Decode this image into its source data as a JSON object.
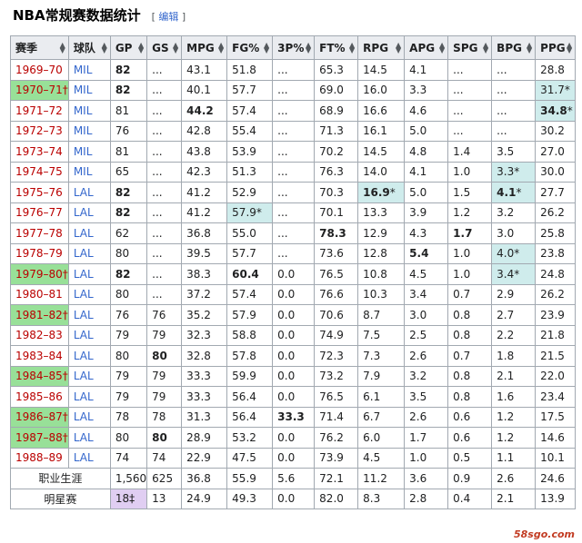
{
  "section": {
    "title": "NBA常规赛数据统计",
    "edit_open": "[",
    "edit_label": "编辑",
    "edit_close": "]"
  },
  "columns": [
    "赛季",
    "球队",
    "GP",
    "GS",
    "MPG",
    "FG%",
    "3P%",
    "FT%",
    "RPG",
    "APG",
    "SPG",
    "BPG",
    "PPG"
  ],
  "colors": {
    "champion": "#98e098",
    "league_leader": "#cfecec",
    "all_star_count": "#e0cef2",
    "link": "#3366cc",
    "redlink": "#ba0000"
  },
  "rows": [
    {
      "season": "1969–70",
      "champ": false,
      "team": "MIL",
      "cells": [
        {
          "v": "82",
          "b": true
        },
        {
          "v": "..."
        },
        {
          "v": "43.1"
        },
        {
          "v": "51.8"
        },
        {
          "v": "..."
        },
        {
          "v": "65.3"
        },
        {
          "v": "14.5"
        },
        {
          "v": "4.1"
        },
        {
          "v": "..."
        },
        {
          "v": "..."
        },
        {
          "v": "28.8"
        }
      ]
    },
    {
      "season": "1970–71†",
      "champ": true,
      "team": "MIL",
      "cells": [
        {
          "v": "82",
          "b": true
        },
        {
          "v": "..."
        },
        {
          "v": "40.1"
        },
        {
          "v": "57.7"
        },
        {
          "v": "..."
        },
        {
          "v": "69.0"
        },
        {
          "v": "16.0"
        },
        {
          "v": "3.3"
        },
        {
          "v": "..."
        },
        {
          "v": "..."
        },
        {
          "v": "31.7*",
          "hl": true
        }
      ]
    },
    {
      "season": "1971–72",
      "champ": false,
      "team": "MIL",
      "cells": [
        {
          "v": "81"
        },
        {
          "v": "..."
        },
        {
          "v": "44.2",
          "b": true
        },
        {
          "v": "57.4"
        },
        {
          "v": "..."
        },
        {
          "v": "68.9"
        },
        {
          "v": "16.6"
        },
        {
          "v": "4.6"
        },
        {
          "v": "..."
        },
        {
          "v": "..."
        },
        {
          "v": "34.8",
          "b": true,
          "suffix": "*",
          "hl": true
        }
      ]
    },
    {
      "season": "1972–73",
      "champ": false,
      "team": "MIL",
      "cells": [
        {
          "v": "76"
        },
        {
          "v": "..."
        },
        {
          "v": "42.8"
        },
        {
          "v": "55.4"
        },
        {
          "v": "..."
        },
        {
          "v": "71.3"
        },
        {
          "v": "16.1"
        },
        {
          "v": "5.0"
        },
        {
          "v": "..."
        },
        {
          "v": "..."
        },
        {
          "v": "30.2"
        }
      ]
    },
    {
      "season": "1973–74",
      "champ": false,
      "team": "MIL",
      "cells": [
        {
          "v": "81"
        },
        {
          "v": "..."
        },
        {
          "v": "43.8"
        },
        {
          "v": "53.9"
        },
        {
          "v": "..."
        },
        {
          "v": "70.2"
        },
        {
          "v": "14.5"
        },
        {
          "v": "4.8"
        },
        {
          "v": "1.4"
        },
        {
          "v": "3.5"
        },
        {
          "v": "27.0"
        }
      ]
    },
    {
      "season": "1974–75",
      "champ": false,
      "team": "MIL",
      "cells": [
        {
          "v": "65"
        },
        {
          "v": "..."
        },
        {
          "v": "42.3"
        },
        {
          "v": "51.3"
        },
        {
          "v": "..."
        },
        {
          "v": "76.3"
        },
        {
          "v": "14.0"
        },
        {
          "v": "4.1"
        },
        {
          "v": "1.0"
        },
        {
          "v": "3.3*",
          "hl": true
        },
        {
          "v": "30.0"
        }
      ]
    },
    {
      "season": "1975–76",
      "champ": false,
      "team": "LAL",
      "cells": [
        {
          "v": "82",
          "b": true
        },
        {
          "v": "..."
        },
        {
          "v": "41.2"
        },
        {
          "v": "52.9"
        },
        {
          "v": "..."
        },
        {
          "v": "70.3"
        },
        {
          "v": "16.9",
          "b": true,
          "suffix": "*",
          "hl": true
        },
        {
          "v": "5.0"
        },
        {
          "v": "1.5"
        },
        {
          "v": "4.1",
          "b": true,
          "suffix": "*",
          "hl": true
        },
        {
          "v": "27.7"
        }
      ]
    },
    {
      "season": "1976–77",
      "champ": false,
      "team": "LAL",
      "cells": [
        {
          "v": "82",
          "b": true
        },
        {
          "v": "..."
        },
        {
          "v": "41.2"
        },
        {
          "v": "57.9*",
          "hl": true
        },
        {
          "v": "..."
        },
        {
          "v": "70.1"
        },
        {
          "v": "13.3"
        },
        {
          "v": "3.9"
        },
        {
          "v": "1.2"
        },
        {
          "v": "3.2"
        },
        {
          "v": "26.2"
        }
      ]
    },
    {
      "season": "1977–78",
      "champ": false,
      "team": "LAL",
      "cells": [
        {
          "v": "62"
        },
        {
          "v": "..."
        },
        {
          "v": "36.8"
        },
        {
          "v": "55.0"
        },
        {
          "v": "..."
        },
        {
          "v": "78.3",
          "b": true
        },
        {
          "v": "12.9"
        },
        {
          "v": "4.3"
        },
        {
          "v": "1.7",
          "b": true
        },
        {
          "v": "3.0"
        },
        {
          "v": "25.8"
        }
      ]
    },
    {
      "season": "1978–79",
      "champ": false,
      "team": "LAL",
      "cells": [
        {
          "v": "80"
        },
        {
          "v": "..."
        },
        {
          "v": "39.5"
        },
        {
          "v": "57.7"
        },
        {
          "v": "..."
        },
        {
          "v": "73.6"
        },
        {
          "v": "12.8"
        },
        {
          "v": "5.4",
          "b": true
        },
        {
          "v": "1.0"
        },
        {
          "v": "4.0*",
          "hl": true
        },
        {
          "v": "23.8"
        }
      ]
    },
    {
      "season": "1979–80†",
      "champ": true,
      "team": "LAL",
      "cells": [
        {
          "v": "82",
          "b": true
        },
        {
          "v": "..."
        },
        {
          "v": "38.3"
        },
        {
          "v": "60.4",
          "b": true
        },
        {
          "v": "0.0"
        },
        {
          "v": "76.5"
        },
        {
          "v": "10.8"
        },
        {
          "v": "4.5"
        },
        {
          "v": "1.0"
        },
        {
          "v": "3.4*",
          "hl": true
        },
        {
          "v": "24.8"
        }
      ]
    },
    {
      "season": "1980–81",
      "champ": false,
      "team": "LAL",
      "cells": [
        {
          "v": "80"
        },
        {
          "v": "..."
        },
        {
          "v": "37.2"
        },
        {
          "v": "57.4"
        },
        {
          "v": "0.0"
        },
        {
          "v": "76.6"
        },
        {
          "v": "10.3"
        },
        {
          "v": "3.4"
        },
        {
          "v": "0.7"
        },
        {
          "v": "2.9"
        },
        {
          "v": "26.2"
        }
      ]
    },
    {
      "season": "1981–82†",
      "champ": true,
      "team": "LAL",
      "cells": [
        {
          "v": "76"
        },
        {
          "v": "76"
        },
        {
          "v": "35.2"
        },
        {
          "v": "57.9"
        },
        {
          "v": "0.0"
        },
        {
          "v": "70.6"
        },
        {
          "v": "8.7"
        },
        {
          "v": "3.0"
        },
        {
          "v": "0.8"
        },
        {
          "v": "2.7"
        },
        {
          "v": "23.9"
        }
      ]
    },
    {
      "season": "1982–83",
      "champ": false,
      "team": "LAL",
      "cells": [
        {
          "v": "79"
        },
        {
          "v": "79"
        },
        {
          "v": "32.3"
        },
        {
          "v": "58.8"
        },
        {
          "v": "0.0"
        },
        {
          "v": "74.9"
        },
        {
          "v": "7.5"
        },
        {
          "v": "2.5"
        },
        {
          "v": "0.8"
        },
        {
          "v": "2.2"
        },
        {
          "v": "21.8"
        }
      ]
    },
    {
      "season": "1983–84",
      "champ": false,
      "team": "LAL",
      "cells": [
        {
          "v": "80"
        },
        {
          "v": "80",
          "b": true
        },
        {
          "v": "32.8"
        },
        {
          "v": "57.8"
        },
        {
          "v": "0.0"
        },
        {
          "v": "72.3"
        },
        {
          "v": "7.3"
        },
        {
          "v": "2.6"
        },
        {
          "v": "0.7"
        },
        {
          "v": "1.8"
        },
        {
          "v": "21.5"
        }
      ]
    },
    {
      "season": "1984–85†",
      "champ": true,
      "team": "LAL",
      "cells": [
        {
          "v": "79"
        },
        {
          "v": "79"
        },
        {
          "v": "33.3"
        },
        {
          "v": "59.9"
        },
        {
          "v": "0.0"
        },
        {
          "v": "73.2"
        },
        {
          "v": "7.9"
        },
        {
          "v": "3.2"
        },
        {
          "v": "0.8"
        },
        {
          "v": "2.1"
        },
        {
          "v": "22.0"
        }
      ]
    },
    {
      "season": "1985–86",
      "champ": false,
      "team": "LAL",
      "cells": [
        {
          "v": "79"
        },
        {
          "v": "79"
        },
        {
          "v": "33.3"
        },
        {
          "v": "56.4"
        },
        {
          "v": "0.0"
        },
        {
          "v": "76.5"
        },
        {
          "v": "6.1"
        },
        {
          "v": "3.5"
        },
        {
          "v": "0.8"
        },
        {
          "v": "1.6"
        },
        {
          "v": "23.4"
        }
      ]
    },
    {
      "season": "1986–87†",
      "champ": true,
      "team": "LAL",
      "cells": [
        {
          "v": "78"
        },
        {
          "v": "78"
        },
        {
          "v": "31.3"
        },
        {
          "v": "56.4"
        },
        {
          "v": "33.3",
          "b": true
        },
        {
          "v": "71.4"
        },
        {
          "v": "6.7"
        },
        {
          "v": "2.6"
        },
        {
          "v": "0.6"
        },
        {
          "v": "1.2"
        },
        {
          "v": "17.5"
        }
      ]
    },
    {
      "season": "1987–88†",
      "champ": true,
      "team": "LAL",
      "cells": [
        {
          "v": "80"
        },
        {
          "v": "80",
          "b": true
        },
        {
          "v": "28.9"
        },
        {
          "v": "53.2"
        },
        {
          "v": "0.0"
        },
        {
          "v": "76.2"
        },
        {
          "v": "6.0"
        },
        {
          "v": "1.7"
        },
        {
          "v": "0.6"
        },
        {
          "v": "1.2"
        },
        {
          "v": "14.6"
        }
      ]
    },
    {
      "season": "1988–89",
      "champ": false,
      "team": "LAL",
      "cells": [
        {
          "v": "74"
        },
        {
          "v": "74"
        },
        {
          "v": "22.9"
        },
        {
          "v": "47.5"
        },
        {
          "v": "0.0"
        },
        {
          "v": "73.9"
        },
        {
          "v": "4.5"
        },
        {
          "v": "1.0"
        },
        {
          "v": "0.5"
        },
        {
          "v": "1.1"
        },
        {
          "v": "10.1"
        }
      ]
    }
  ],
  "summary": [
    {
      "label": "职业生涯",
      "cells": [
        {
          "v": "1,560"
        },
        {
          "v": "625"
        },
        {
          "v": "36.8"
        },
        {
          "v": "55.9"
        },
        {
          "v": "5.6"
        },
        {
          "v": "72.1"
        },
        {
          "v": "11.2"
        },
        {
          "v": "3.6"
        },
        {
          "v": "0.9"
        },
        {
          "v": "2.6"
        },
        {
          "v": "24.6"
        }
      ]
    },
    {
      "label": "明星赛",
      "cells": [
        {
          "v": "18‡",
          "allstar": true
        },
        {
          "v": "13"
        },
        {
          "v": "24.9"
        },
        {
          "v": "49.3"
        },
        {
          "v": "0.0"
        },
        {
          "v": "82.0"
        },
        {
          "v": "8.3"
        },
        {
          "v": "2.8"
        },
        {
          "v": "0.4"
        },
        {
          "v": "2.1"
        },
        {
          "v": "13.9"
        }
      ]
    }
  ],
  "watermark": "58sgo.com"
}
